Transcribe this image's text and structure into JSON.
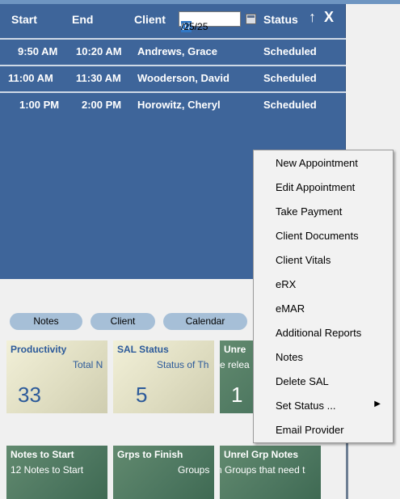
{
  "header": {
    "start": "Start",
    "end": "End",
    "client": "Client",
    "date_selected": "07",
    "date_rest": "/25/25",
    "status": "Status",
    "up_icon": "↑",
    "close_icon": "X"
  },
  "appointments": [
    {
      "start": "9:50 AM",
      "end": "10:20 AM",
      "client": "Andrews, Grace",
      "status": "Scheduled"
    },
    {
      "start": "11:00 AM",
      "end": "11:30 AM",
      "client": "Wooderson, David",
      "status": "Scheduled"
    },
    {
      "start": "1:00 PM",
      "end": "2:00 PM",
      "client": "Horowitz, Cheryl",
      "status": "Scheduled"
    }
  ],
  "tabs": [
    "Notes",
    "Client",
    "Calendar"
  ],
  "tiles": [
    {
      "title": "Productivity",
      "sub": "Total N",
      "value": "33"
    },
    {
      "title": "SAL Status",
      "sub": "Status of Th",
      "value": "5"
    },
    {
      "title": "Unre",
      "sub": "e relea",
      "value": "1"
    },
    {
      "title": "Notes to Start",
      "sub": "12 Notes to Start"
    },
    {
      "title": "Grps to Finish",
      "sub": "Groups"
    },
    {
      "title": "Unrel Grp Notes",
      "sub": "n Groups that need t"
    }
  ],
  "context_menu": [
    "New Appointment",
    "Edit Appointment",
    "Take Payment",
    "Client Documents",
    "Client Vitals",
    "eRX",
    "eMAR",
    "Additional Reports",
    "Notes",
    "Delete SAL",
    "Set Status ...",
    "Email Provider"
  ],
  "submenu_arrow": "▶"
}
